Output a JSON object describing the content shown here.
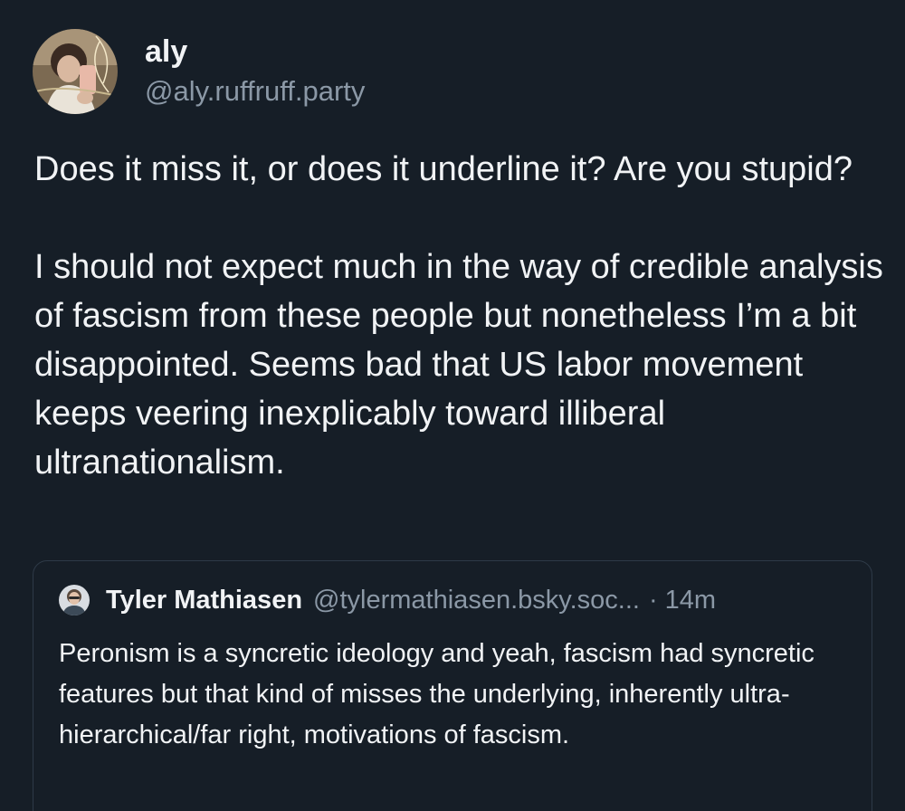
{
  "post": {
    "author": {
      "display_name": "aly",
      "handle": "@aly.ruffruff.party",
      "avatar_icon": "profile-photo-avatar"
    },
    "paragraphs": [
      "Does it miss it, or does it underline it? Are you stupid?",
      "I should not expect much in the way of credible analysis of fascism from these people but nonetheless I’m a bit disappointed. Seems bad that US labor movement keeps veering inexplicably toward illiberal ultranationalism."
    ]
  },
  "quote": {
    "author": {
      "display_name": "Tyler Mathiasen",
      "handle": "@tylermathiasen.bsky.soc...",
      "avatar_icon": "profile-photo-avatar"
    },
    "separator": "·",
    "time": "14m",
    "text": "Peronism is a syncretic ideology and yeah, fascism had syncretic features but that kind of misses the underlying, inherently ultra-hierarchical/far right, motivations of fascism."
  },
  "colors": {
    "background": "#161e27",
    "text_primary": "#f1f3f5",
    "text_secondary": "#8b98a6",
    "card_border": "#2e3a47"
  }
}
